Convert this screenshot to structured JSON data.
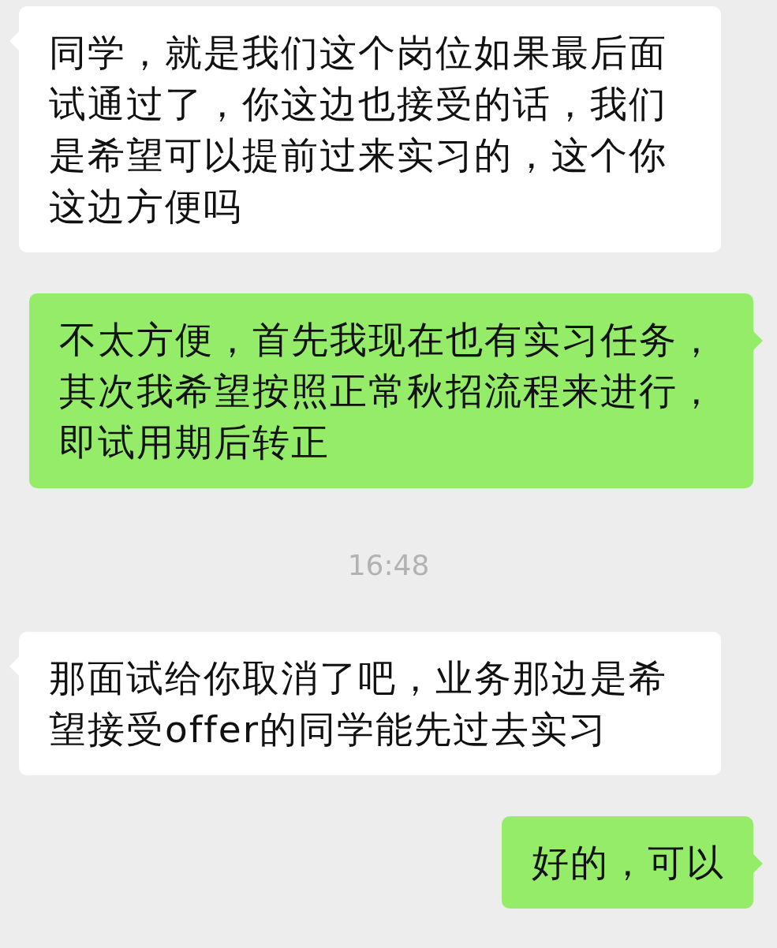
{
  "messages": [
    {
      "kind": "incoming",
      "text": "同学，就是我们这个岗位如果最后面试通过了，你这边也接受的话，我们是希望可以提前过来实习的，这个你这边方便吗"
    },
    {
      "kind": "outgoing",
      "text": "不太方便，首先我现在也有实习任务，其次我希望按照正常秋招流程来进行，即试用期后转正"
    },
    {
      "kind": "time",
      "text": "16:48"
    },
    {
      "kind": "incoming",
      "text": "那面试给你取消了吧，业务那边是希望接受offer的同学能先过去实习"
    },
    {
      "kind": "outgoing",
      "text": "好的，可以"
    }
  ]
}
